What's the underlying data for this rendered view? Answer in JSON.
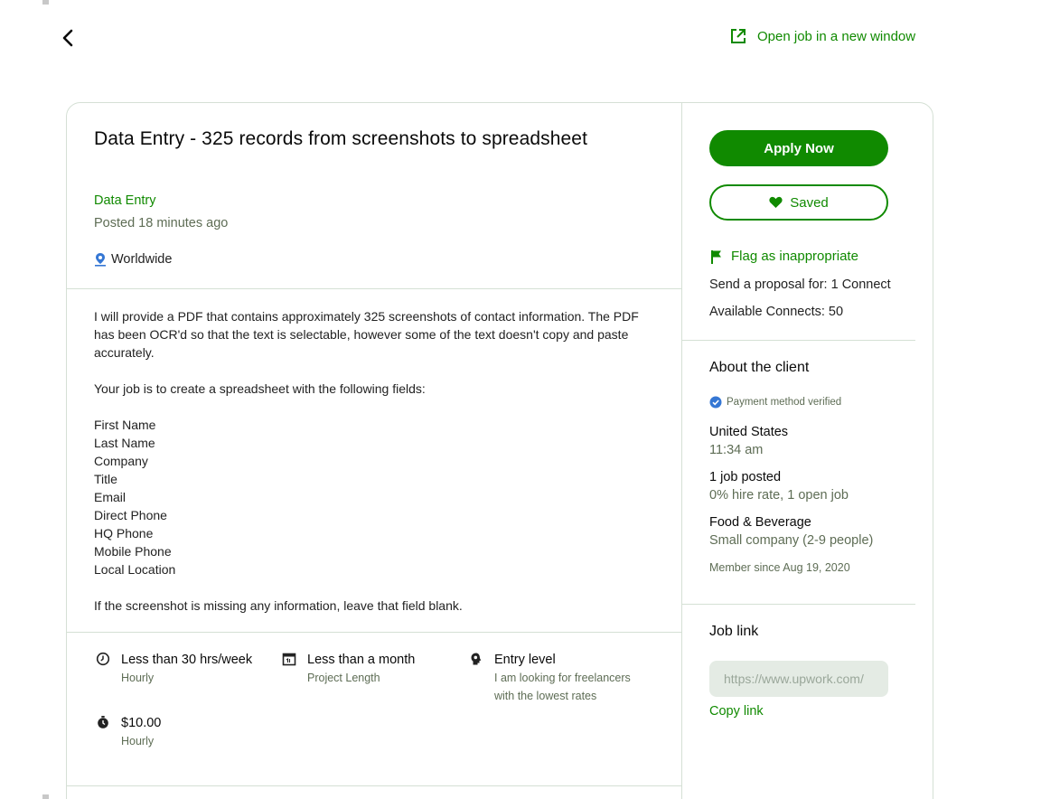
{
  "header": {
    "open_new_window": "Open job in a new window"
  },
  "job": {
    "title": "Data Entry - 325 records from screenshots to spreadsheet",
    "category": "Data Entry",
    "posted": "Posted 18 minutes ago",
    "location": "Worldwide",
    "description": {
      "para1": "I will provide a PDF that contains approximately 325 screenshots of contact information. The PDF has been OCR'd so that the text is selectable, however some of the text doesn't copy and paste accurately.",
      "para2": "Your job is to create a spreadsheet with the following fields:",
      "fields": [
        "First Name",
        "Last Name",
        "Company",
        "Title",
        "Email",
        "Direct Phone",
        "HQ Phone",
        "Mobile Phone",
        "Local Location"
      ],
      "para3": "If the screenshot is missing any information, leave that field blank."
    },
    "features": {
      "hours": {
        "main": "Less than 30 hrs/week",
        "sub": "Hourly"
      },
      "length": {
        "main": "Less than a month",
        "sub": "Project Length"
      },
      "level": {
        "main": "Entry level",
        "sub1": "I am looking for freelancers",
        "sub2": "with the lowest rates"
      },
      "rate": {
        "main": "$10.00",
        "sub": "Hourly"
      }
    }
  },
  "sidebar": {
    "apply_label": "Apply Now",
    "saved_label": "Saved",
    "flag_label": "Flag as inappropriate",
    "proposal_cost": "Send a proposal for: 1 Connect",
    "available_connects": "Available Connects: 50"
  },
  "client": {
    "title": "About the client",
    "payment_verified": "Payment method verified",
    "country": "United States",
    "local_time": "11:34 am",
    "jobs_posted": "1 job posted",
    "hire_rate": "0% hire rate, 1 open job",
    "industry": "Food & Beverage",
    "company_size": "Small company (2-9 people)",
    "member_since": "Member since Aug 19, 2020"
  },
  "job_link": {
    "title": "Job link",
    "url": "https://www.upwork.com/",
    "copy_label": "Copy link"
  },
  "colors": {
    "brand_green": "#108a00",
    "border": "#d5e0d5",
    "muted_text": "#5e6d55",
    "verified_blue": "#3577d4"
  }
}
